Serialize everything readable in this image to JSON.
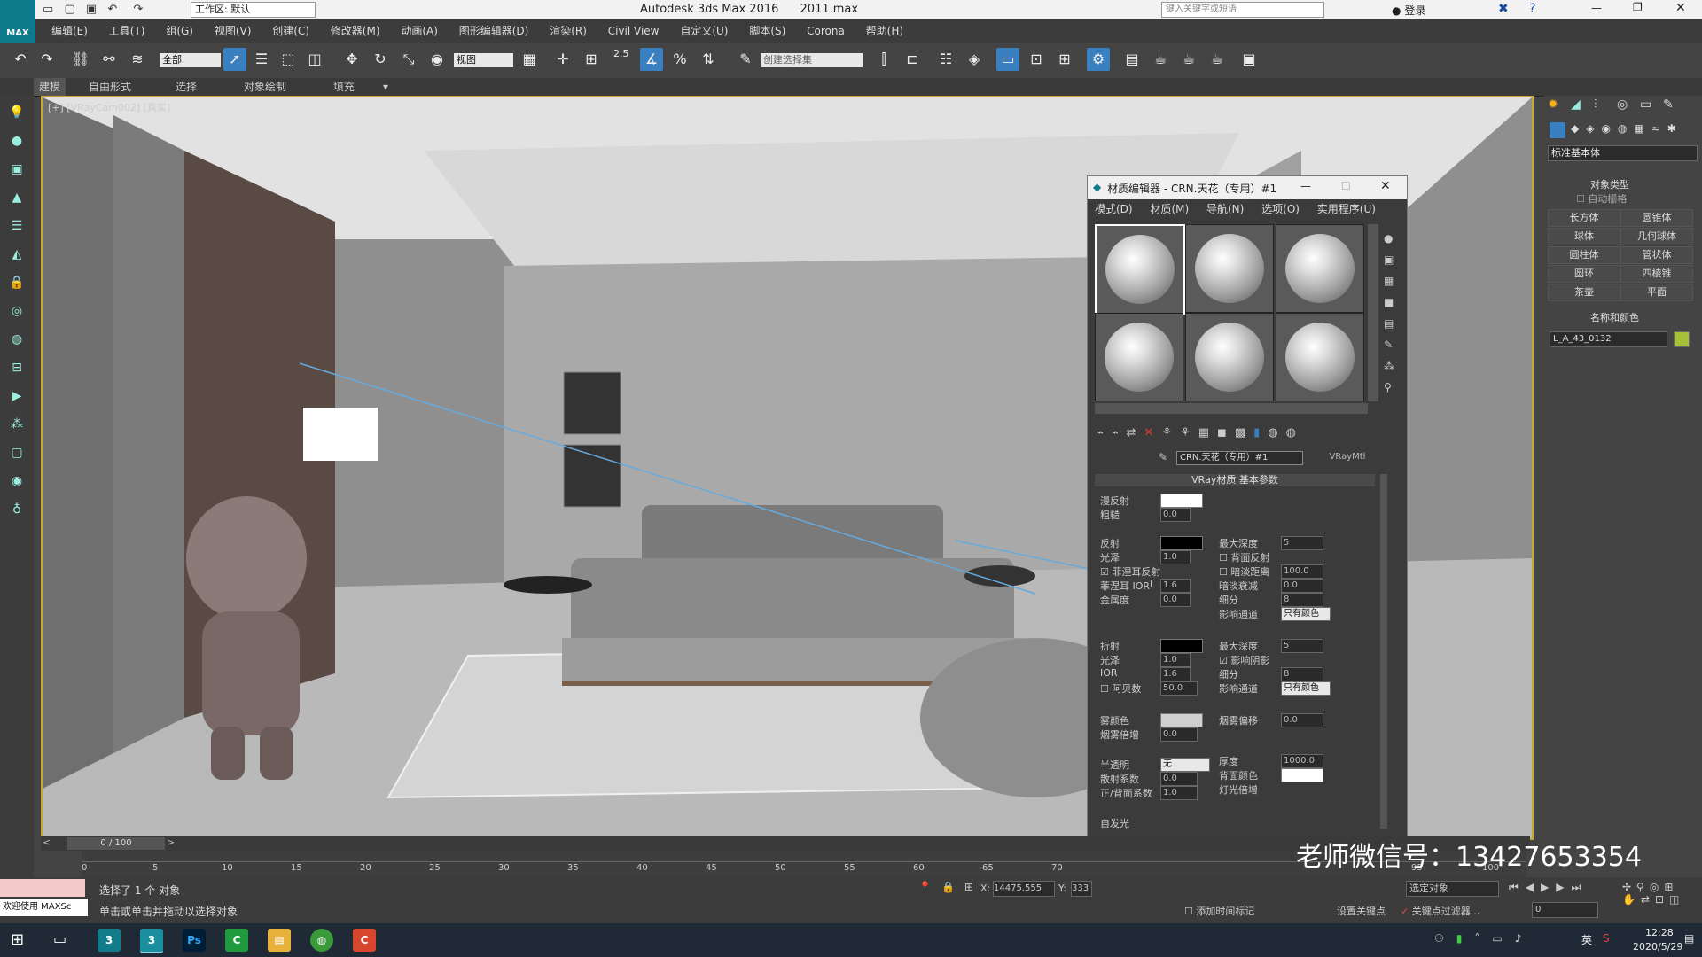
{
  "app": {
    "title": "Autodesk 3ds Max 2016",
    "file": "2011.max",
    "workspace": "工作区: 默认",
    "search_placeholder": "键入关键字或短语",
    "login": "登录"
  },
  "menu": [
    "编辑(E)",
    "工具(T)",
    "组(G)",
    "视图(V)",
    "创建(C)",
    "修改器(M)",
    "动画(A)",
    "图形编辑器(D)",
    "渲染(R)",
    "Civil View",
    "自定义(U)",
    "脚本(S)",
    "Corona",
    "帮助(H)"
  ],
  "toolbar": {
    "filter": "全部",
    "view": "视图",
    "snap_value": "2.5",
    "selection_set": "创建选择集"
  },
  "ribbon": [
    "建模",
    "自由形式",
    "选择",
    "对象绘制",
    "填充"
  ],
  "viewport": {
    "label": "[+] [VRayCam002] [真实]"
  },
  "material_editor": {
    "title": "材质编辑器 - CRN.天花（专用）#1",
    "menu": [
      "模式(D)",
      "材质(M)",
      "导航(N)",
      "选项(O)",
      "实用程序(U)"
    ],
    "material_name": "CRN.天花（专用）#1",
    "material_type": "VRayMtl",
    "rollout_title": "VRay材质 基本参数",
    "diffuse": {
      "label": "漫反射",
      "roughness_label": "粗糙",
      "roughness": "0.0"
    },
    "reflection": {
      "label": "反射",
      "gloss_label": "光泽",
      "gloss": "1.0",
      "fresnel_label": "菲涅耳反射",
      "fresnel_ior_label": "菲涅耳 IOR",
      "fresnel_ior_l": "L",
      "fresnel_ior": "1.6",
      "metal_label": "金属度",
      "metal": "0.0",
      "max_depth_label": "最大深度",
      "max_depth": "5",
      "back_reflect_label": "背面反射",
      "dim_distance_label": "暗淡距离",
      "dim_distance": "100.0",
      "dim_falloff_label": "暗淡衰减",
      "dim_falloff": "0.0",
      "subdivs_label": "细分",
      "subdivs": "8",
      "affect_channels_label": "影响通道",
      "affect_channels": "只有颜色"
    },
    "refraction": {
      "label": "折射",
      "gloss_label": "光泽",
      "gloss": "1.0",
      "ior_label": "IOR",
      "ior": "1.6",
      "abbe_label": "阿贝数",
      "abbe": "50.0",
      "max_depth_label": "最大深度",
      "max_depth": "5",
      "affect_shadows_label": "影响阴影",
      "subdivs_label": "细分",
      "subdivs": "8",
      "affect_channels_label": "影响通道",
      "affect_channels": "只有颜色"
    },
    "fog": {
      "color_label": "雾颜色",
      "multiplier_label": "烟雾倍增",
      "multiplier": "0.0",
      "bias_label": "烟雾偏移",
      "bias": "0.0"
    },
    "translucency": {
      "label": "半透明",
      "value": "无",
      "scatter_label": "散射系数",
      "scatter": "0.0",
      "fb_label": "正/背面系数",
      "fb": "1.0",
      "thickness_label": "厚度",
      "thickness": "1000.0",
      "back_color_label": "背面颜色",
      "light_mult_label": "灯光倍增"
    },
    "self_illum_label": "自发光"
  },
  "command_panel": {
    "dropdown": "标准基本体",
    "object_type_title": "对象类型",
    "autogrid": "自动栅格",
    "buttons": [
      "长方体",
      "圆锥体",
      "球体",
      "几何球体",
      "圆柱体",
      "管状体",
      "圆环",
      "四棱锥",
      "茶壶",
      "平面"
    ],
    "name_color_title": "名称和颜色",
    "object_name": "L_A_43_0132",
    "object_color": "#a8c038"
  },
  "timeline": {
    "frame": "0 / 100",
    "ticks": [
      "0",
      "5",
      "10",
      "15",
      "20",
      "25",
      "30",
      "35",
      "40",
      "45",
      "50",
      "55",
      "60",
      "65",
      "70",
      "95",
      "100"
    ]
  },
  "status": {
    "selection": "选择了 1 个 对象",
    "hint": "单击或单击并拖动以选择对象",
    "welcome": "欢迎使用 MAXSc",
    "x_label": "X:",
    "x": "14475.555",
    "y_label": "Y:",
    "y": "333",
    "add_time_tag": "添加时间标记",
    "set_key": "设置关键点",
    "key_filter": "关键点过滤器...",
    "selected": "选定对象",
    "frame_field": "0"
  },
  "taskbar": {
    "time": "12:28",
    "date": "2020/5/29",
    "ime": "英"
  },
  "watermark": "老师微信号：13427653354",
  "colors": {
    "accent": "#c9a928",
    "title_bg": "#f0f0f0"
  }
}
